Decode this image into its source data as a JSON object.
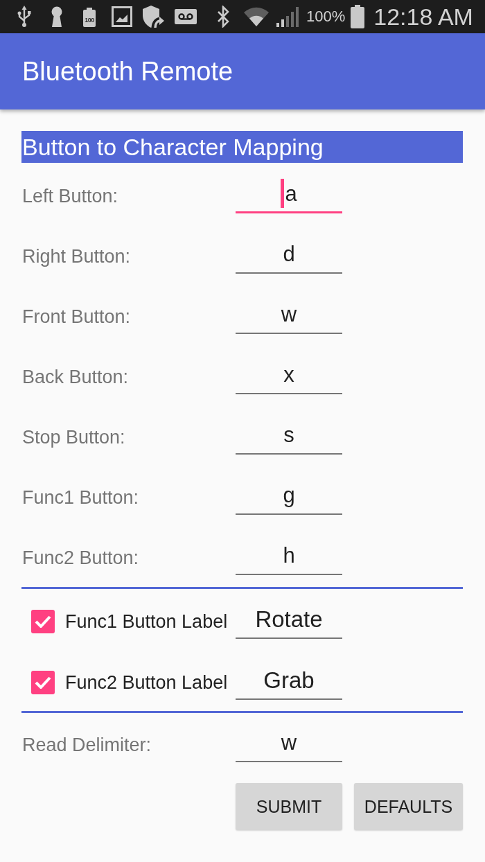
{
  "status_bar": {
    "notification_badge": "100",
    "battery_percent": "100%",
    "time": "12:18 AM"
  },
  "app_bar": {
    "title": "Bluetooth Remote"
  },
  "section_header": {
    "title": "Button to Character Mapping"
  },
  "mappings": [
    {
      "label": "Left Button:",
      "value": "a",
      "focused": true
    },
    {
      "label": "Right Button:",
      "value": "d",
      "focused": false
    },
    {
      "label": "Front Button:",
      "value": "w",
      "focused": false
    },
    {
      "label": "Back Button:",
      "value": "x",
      "focused": false
    },
    {
      "label": "Stop Button:",
      "value": "s",
      "focused": false
    },
    {
      "label": "Func1 Button:",
      "value": "g",
      "focused": false
    },
    {
      "label": "Func2 Button:",
      "value": "h",
      "focused": false
    }
  ],
  "button_labels": [
    {
      "label": "Func1 Button Label",
      "checked": true,
      "value": "Rotate",
      "focused": false
    },
    {
      "label": "Func2 Button Label",
      "checked": true,
      "value": "Grab",
      "focused": false
    }
  ],
  "delimiter": {
    "label": "Read Delimiter:",
    "value": "w",
    "focused": false
  },
  "buttons": [
    {
      "label": "SUBMIT"
    },
    {
      "label": "DEFAULTS"
    }
  ]
}
